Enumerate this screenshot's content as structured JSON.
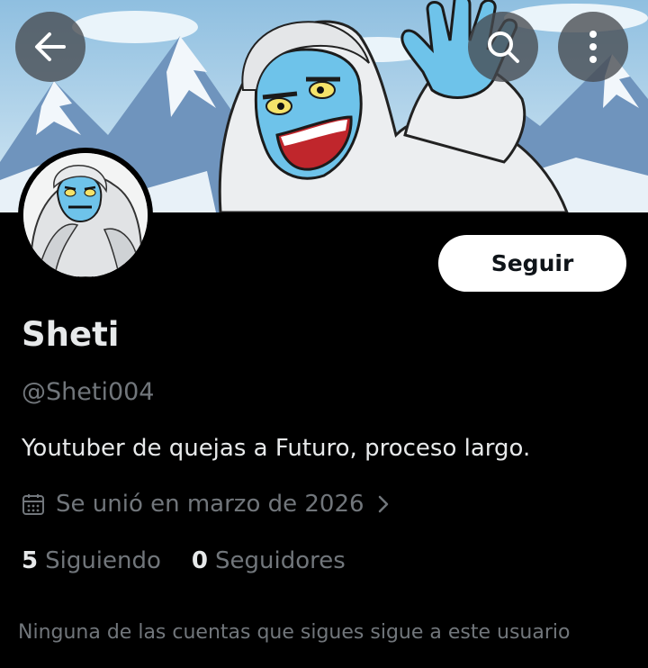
{
  "header": {
    "back_icon": "arrow-left-icon",
    "search_icon": "search-icon",
    "more_icon": "more-vertical-icon"
  },
  "profile": {
    "name": "Sheti",
    "handle": "@Sheti004",
    "bio": "Youtuber de quejas a Futuro, proceso largo.",
    "joined": "Se unió en marzo de 2026",
    "follow_label": "Seguir",
    "following_count": "5",
    "following_label": "Siguiendo",
    "followers_count": "0",
    "followers_label": "Seguidores",
    "mutual_note": "Ninguna de las cuentas que sigues sigue a este usuario"
  },
  "colors": {
    "background": "#000000",
    "primary_text": "#e7e9ea",
    "secondary_text": "#71767b",
    "yeti_face": "#6ec3ea",
    "sky": "#a9cfe6"
  }
}
